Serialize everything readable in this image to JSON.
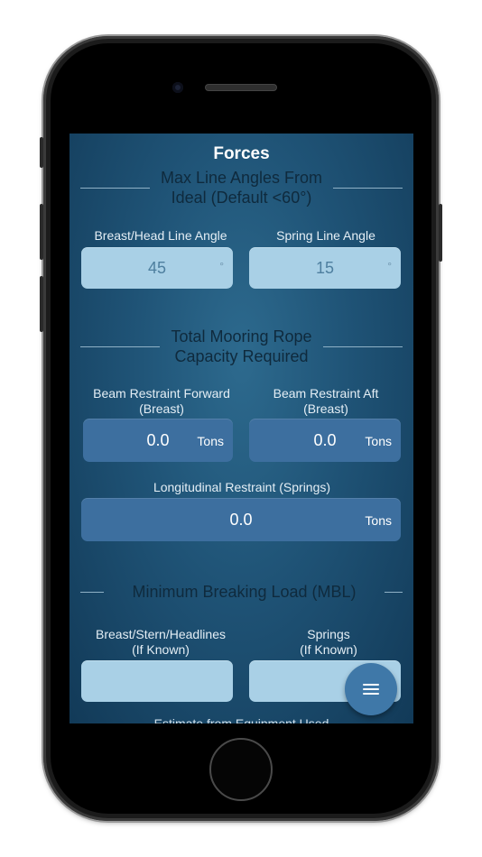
{
  "header": {
    "title": "Forces"
  },
  "sections": {
    "angles": {
      "heading_line1": "Max Line Angles From",
      "heading_line2": "Ideal (Default <60°)"
    },
    "capacity": {
      "heading_line1": "Total Mooring Rope",
      "heading_line2": "Capacity Required"
    },
    "mbl": {
      "heading": "Minimum Breaking Load (MBL)"
    }
  },
  "angle_fields": {
    "breast": {
      "label": "Breast/Head Line Angle",
      "value": "45",
      "unit": "°"
    },
    "spring": {
      "label": "Spring Line Angle",
      "value": "15",
      "unit": "°"
    }
  },
  "capacity_fields": {
    "forward": {
      "label_line1": "Beam Restraint Forward",
      "label_line2": "(Breast)",
      "value": "0.0",
      "unit": "Tons"
    },
    "aft": {
      "label_line1": "Beam Restraint Aft",
      "label_line2": "(Breast)",
      "value": "0.0",
      "unit": "Tons"
    },
    "longitudinal": {
      "label": "Longitudinal Restraint (Springs)",
      "value": "0.0",
      "unit": "Tons"
    }
  },
  "mbl_fields": {
    "breast": {
      "label_line1": "Breast/Stern/Headlines",
      "label_line2": "(If Known)",
      "value": ""
    },
    "springs": {
      "label_line1": "Springs",
      "label_line2": "(If Known)",
      "value": ""
    }
  },
  "partial_text": "Estimate from Equipment Used",
  "menu_fab": {
    "icon": "hamburger-menu-icon"
  },
  "colors": {
    "screen_bg": "#1f5376",
    "input_light": "#a9d0e6",
    "output_dark": "#3d6f9f",
    "fab": "#3f78a8"
  }
}
